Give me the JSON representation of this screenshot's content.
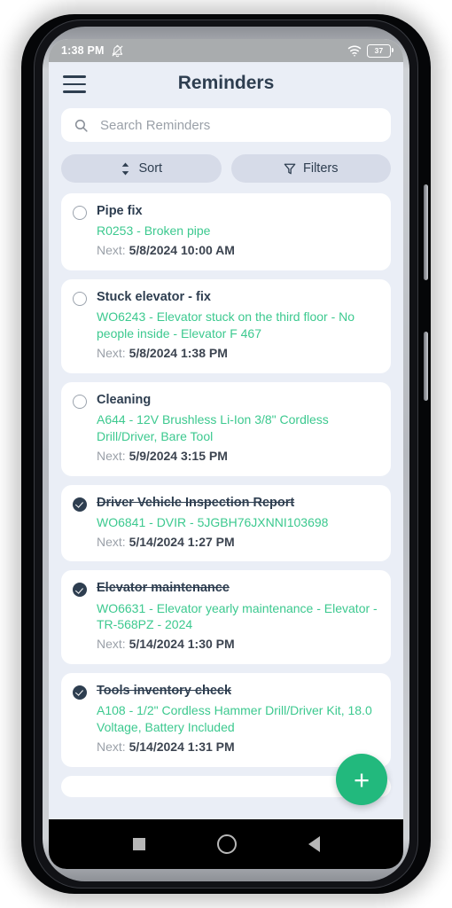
{
  "status_bar": {
    "time": "1:38 PM",
    "alarm_off_icon": "bell-off-icon",
    "wifi_icon": "wifi-icon",
    "battery_level": "37"
  },
  "header": {
    "menu_icon": "hamburger-menu-icon",
    "title": "Reminders"
  },
  "search": {
    "icon": "search-icon",
    "value": "",
    "placeholder": "Search Reminders"
  },
  "toolbar": {
    "sort_label": "Sort",
    "sort_icon": "sort-updown-icon",
    "filters_label": "Filters",
    "filters_icon": "funnel-icon"
  },
  "fab": {
    "label": "+",
    "name": "add-reminder-button",
    "color": "#22b97d"
  },
  "nav_bar": {
    "recents": "recents-square-icon",
    "home": "home-circle-icon",
    "back": "back-triangle-icon"
  },
  "colors": {
    "background": "#eaeef6",
    "card": "#ffffff",
    "accent_green": "#3cc98f",
    "text_dark": "#2e3e50",
    "text_muted": "#9aa0a8"
  },
  "next_label": "Next:",
  "reminders": [
    {
      "title": "Pipe fix",
      "description": "R0253 - Broken pipe",
      "next": "5/8/2024 10:00 AM",
      "completed": false
    },
    {
      "title": "Stuck elevator - fix",
      "description": "WO6243 - Elevator stuck on the third floor - No people inside - Elevator F 467",
      "next": "5/8/2024 1:38 PM",
      "completed": false
    },
    {
      "title": "Cleaning",
      "description": "A644 - 12V Brushless Li-Ion 3/8\" Cordless Drill/Driver, Bare Tool",
      "next": "5/9/2024 3:15 PM",
      "completed": false
    },
    {
      "title": "Driver Vehicle Inspection Report",
      "description": "WO6841 - DVIR - 5JGBH76JXNNI103698",
      "next": "5/14/2024 1:27 PM",
      "completed": true
    },
    {
      "title": "Elevator maintenance",
      "description": "WO6631 - Elevator yearly maintenance - Elevator - TR-568PZ - 2024",
      "next": "5/14/2024 1:30 PM",
      "completed": true
    },
    {
      "title": "Tools inventory check",
      "description": "A108 - 1/2\" Cordless Hammer Drill/Driver Kit, 18.0 Voltage, Battery Included",
      "next": "5/14/2024 1:31 PM",
      "completed": true
    },
    {
      "title": "",
      "description": "",
      "next": "",
      "completed": false
    }
  ]
}
